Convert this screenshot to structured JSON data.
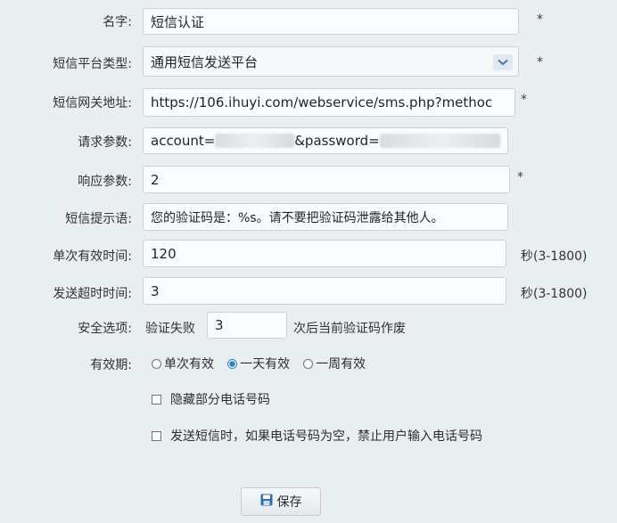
{
  "form": {
    "name": {
      "label": "名字:",
      "value": "短信认证",
      "required": "*"
    },
    "platform_type": {
      "label": "短信平台类型:",
      "value": "通用短信发送平台",
      "required": "*"
    },
    "gateway": {
      "label": "短信网关地址:",
      "value": "https://106.ihuyi.com/webservice/sms.php?methoc",
      "required": "*"
    },
    "request_params": {
      "label": "请求参数:",
      "value_prefix": "account=",
      "value_mid": "&password="
    },
    "response_params": {
      "label": "响应参数:",
      "value": "2",
      "required": "*"
    },
    "prompt": {
      "label": "短信提示语:",
      "value": "您的验证码是：%s。请不要把验证码泄露给其他人。"
    },
    "valid_time": {
      "label": "单次有效时间:",
      "value": "120",
      "suffix": "秒(3-1800)"
    },
    "timeout": {
      "label": "发送超时时间:",
      "value": "3",
      "suffix": "秒(3-1800)"
    },
    "security": {
      "label": "安全选项:",
      "prefix": "验证失败",
      "value": "3",
      "suffix": "次后当前验证码作废"
    },
    "validity": {
      "label": "有效期:",
      "options": [
        {
          "label": "单次有效",
          "selected": false
        },
        {
          "label": "一天有效",
          "selected": true
        },
        {
          "label": "一周有效",
          "selected": false
        }
      ]
    },
    "hide_phone": {
      "label": "隐藏部分电话号码",
      "checked": false
    },
    "forbid_input": {
      "label": "发送短信时，如果电话号码为空，禁止用户输入电话号码",
      "checked": false
    }
  },
  "actions": {
    "save_label": "保存"
  },
  "colors": {
    "accent": "#2f7fd0",
    "background": "#e9eef1"
  },
  "icons": {
    "select": "chevron-down-icon",
    "save": "save-icon"
  }
}
